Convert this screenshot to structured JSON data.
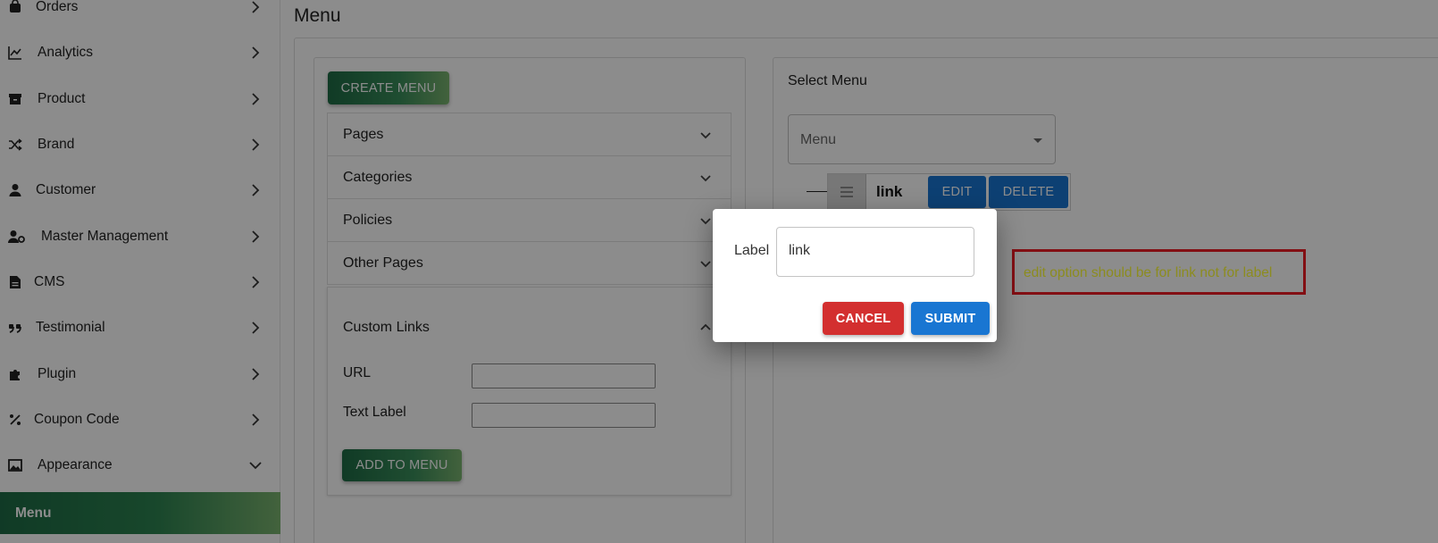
{
  "sidebar": {
    "items": [
      {
        "label": "Orders",
        "icon": "bag-icon"
      },
      {
        "label": "Analytics",
        "icon": "chart-icon"
      },
      {
        "label": "Product",
        "icon": "archive-icon"
      },
      {
        "label": "Brand",
        "icon": "shuffle-icon"
      },
      {
        "label": "Customer",
        "icon": "person-icon"
      },
      {
        "label": "Master Management",
        "icon": "user-gear-icon"
      },
      {
        "label": "CMS",
        "icon": "document-icon"
      },
      {
        "label": "Testimonial",
        "icon": "quote-icon"
      },
      {
        "label": "Plugin",
        "icon": "puzzle-icon"
      },
      {
        "label": "Coupon Code",
        "icon": "percent-icon"
      },
      {
        "label": "Appearance",
        "icon": "image-icon"
      }
    ],
    "active_item": "Menu"
  },
  "page": {
    "title": "Menu"
  },
  "left_panel": {
    "create_button": "CREATE MENU",
    "accordions": [
      "Pages",
      "Categories",
      "Policies",
      "Other Pages"
    ],
    "custom_links": {
      "title": "Custom Links",
      "url_label": "URL",
      "url_value": "",
      "text_label": "Text Label",
      "text_value": "",
      "add_button": "ADD TO MENU"
    }
  },
  "right_panel": {
    "select_label": "Select Menu",
    "select_value": "Menu",
    "menu_item": {
      "label": "link",
      "edit": "EDIT",
      "delete": "DELETE"
    }
  },
  "annotation": {
    "text": "edit option should be for link not for label",
    "color": "#ee1c25",
    "text_color": "#ffff3b"
  },
  "dialog": {
    "label": "Label",
    "value": "link",
    "cancel": "CANCEL",
    "submit": "SUBMIT",
    "cancel_color": "#d32f2f",
    "submit_color": "#1976d2"
  }
}
